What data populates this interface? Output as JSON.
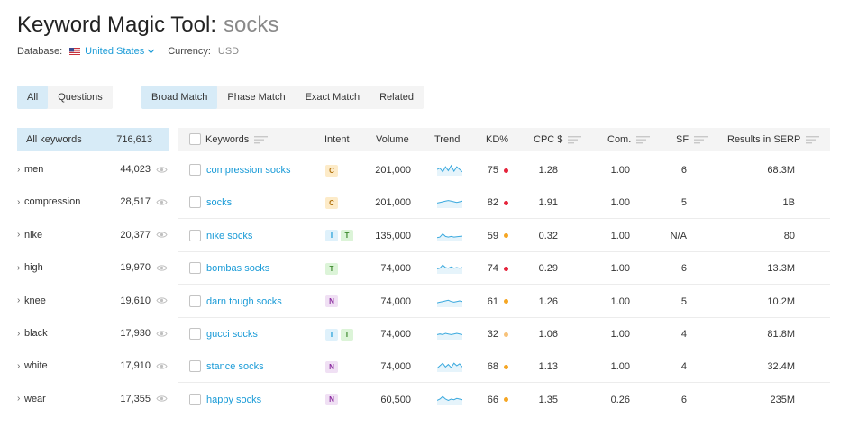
{
  "header": {
    "title": "Keyword Magic Tool:",
    "query": "socks",
    "database_label": "Database:",
    "database_value": "United States",
    "currency_label": "Currency:",
    "currency_value": "USD"
  },
  "tabs_group1": [
    "All",
    "Questions"
  ],
  "tabs_group2": [
    "Broad Match",
    "Phase Match",
    "Exact Match",
    "Related"
  ],
  "left_panel": {
    "header_label": "All keywords",
    "header_count": "716,613",
    "items": [
      {
        "label": "men",
        "count": "44,023"
      },
      {
        "label": "compression",
        "count": "28,517"
      },
      {
        "label": "nike",
        "count": "20,377"
      },
      {
        "label": "high",
        "count": "19,970"
      },
      {
        "label": "knee",
        "count": "19,610"
      },
      {
        "label": "black",
        "count": "17,930"
      },
      {
        "label": "white",
        "count": "17,910"
      },
      {
        "label": "wear",
        "count": "17,355"
      }
    ]
  },
  "table": {
    "columns": [
      "Keywords",
      "Intent",
      "Volume",
      "Trend",
      "KD%",
      "CPC $",
      "Com.",
      "SF",
      "Results in SERP"
    ],
    "rows": [
      {
        "keyword": "compression socks",
        "intent": [
          "C"
        ],
        "volume": "201,000",
        "trend": [
          0.5,
          0.6,
          0.3,
          0.7,
          0.4,
          0.8,
          0.35,
          0.7,
          0.5,
          0.3
        ],
        "kd": "75",
        "kd_color": "#e5233b",
        "cpc": "1.28",
        "com": "1.00",
        "sf": "6",
        "results": "68.3M"
      },
      {
        "keyword": "socks",
        "intent": [
          "C"
        ],
        "volume": "201,000",
        "trend": [
          0.4,
          0.45,
          0.5,
          0.55,
          0.6,
          0.55,
          0.5,
          0.45,
          0.5,
          0.55
        ],
        "kd": "82",
        "kd_color": "#e5233b",
        "cpc": "1.91",
        "com": "1.00",
        "sf": "5",
        "results": "1B"
      },
      {
        "keyword": "nike socks",
        "intent": [
          "I",
          "T"
        ],
        "volume": "135,000",
        "trend": [
          0.3,
          0.35,
          0.6,
          0.4,
          0.35,
          0.4,
          0.35,
          0.38,
          0.4,
          0.42
        ],
        "kd": "59",
        "kd_color": "#f5a623",
        "cpc": "0.32",
        "com": "1.00",
        "sf": "N/A",
        "results": "80"
      },
      {
        "keyword": "bombas socks",
        "intent": [
          "T"
        ],
        "volume": "74,000",
        "trend": [
          0.4,
          0.45,
          0.7,
          0.5,
          0.45,
          0.55,
          0.45,
          0.5,
          0.45,
          0.5
        ],
        "kd": "74",
        "kd_color": "#e5233b",
        "cpc": "0.29",
        "com": "1.00",
        "sf": "6",
        "results": "13.3M"
      },
      {
        "keyword": "darn tough socks",
        "intent": [
          "N"
        ],
        "volume": "74,000",
        "trend": [
          0.35,
          0.4,
          0.45,
          0.5,
          0.55,
          0.45,
          0.4,
          0.45,
          0.5,
          0.45
        ],
        "kd": "61",
        "kd_color": "#f5a623",
        "cpc": "1.26",
        "com": "1.00",
        "sf": "5",
        "results": "10.2M"
      },
      {
        "keyword": "gucci socks",
        "intent": [
          "I",
          "T"
        ],
        "volume": "74,000",
        "trend": [
          0.4,
          0.45,
          0.4,
          0.5,
          0.45,
          0.4,
          0.45,
          0.5,
          0.45,
          0.4
        ],
        "kd": "32",
        "kd_color": "#f7c27a",
        "cpc": "1.06",
        "com": "1.00",
        "sf": "4",
        "results": "81.8M"
      },
      {
        "keyword": "stance socks",
        "intent": [
          "N"
        ],
        "volume": "74,000",
        "trend": [
          0.3,
          0.5,
          0.7,
          0.4,
          0.6,
          0.35,
          0.7,
          0.5,
          0.65,
          0.4
        ],
        "kd": "68",
        "kd_color": "#f5a623",
        "cpc": "1.13",
        "com": "1.00",
        "sf": "4",
        "results": "32.4M"
      },
      {
        "keyword": "happy socks",
        "intent": [
          "N"
        ],
        "volume": "60,500",
        "trend": [
          0.4,
          0.5,
          0.7,
          0.5,
          0.4,
          0.5,
          0.45,
          0.55,
          0.5,
          0.45
        ],
        "kd": "66",
        "kd_color": "#f5a623",
        "cpc": "1.35",
        "com": "0.26",
        "sf": "6",
        "results": "235M"
      }
    ]
  },
  "colors": {
    "accent": "#1a9bd7",
    "active_bg": "#d7ebf7",
    "header_bg": "#f4f4f4"
  },
  "icons": {
    "sort": "sort-icon",
    "eye": "eye-icon",
    "flag": "us-flag-icon",
    "chevron": "chevron-down-icon"
  }
}
